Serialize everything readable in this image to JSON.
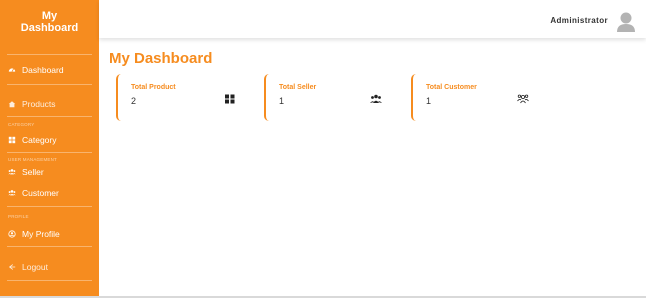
{
  "sidebar": {
    "brand_line1": "My",
    "brand_line2": "Dashboard",
    "items": {
      "dashboard": "Dashboard",
      "products": "Products",
      "category_section": "CATEGORY",
      "category": "Category",
      "user_section": "USER MANAGEMENT",
      "seller": "Seller",
      "customer": "Customer",
      "profile_section": "PROFILE",
      "my_profile": "My Profile",
      "logout": "Logout"
    }
  },
  "header": {
    "user_name": "Administrator"
  },
  "main": {
    "title": "My Dashboard",
    "cards": [
      {
        "label": "Total Product",
        "value": "2",
        "icon": "grid-icon"
      },
      {
        "label": "Total Seller",
        "value": "1",
        "icon": "users-icon"
      },
      {
        "label": "Total Customer",
        "value": "1",
        "icon": "user-group-outline-icon"
      }
    ]
  },
  "colors": {
    "accent": "#f68c1f",
    "sidebar_bg": "#f68c1f",
    "text_dark": "#333333"
  }
}
